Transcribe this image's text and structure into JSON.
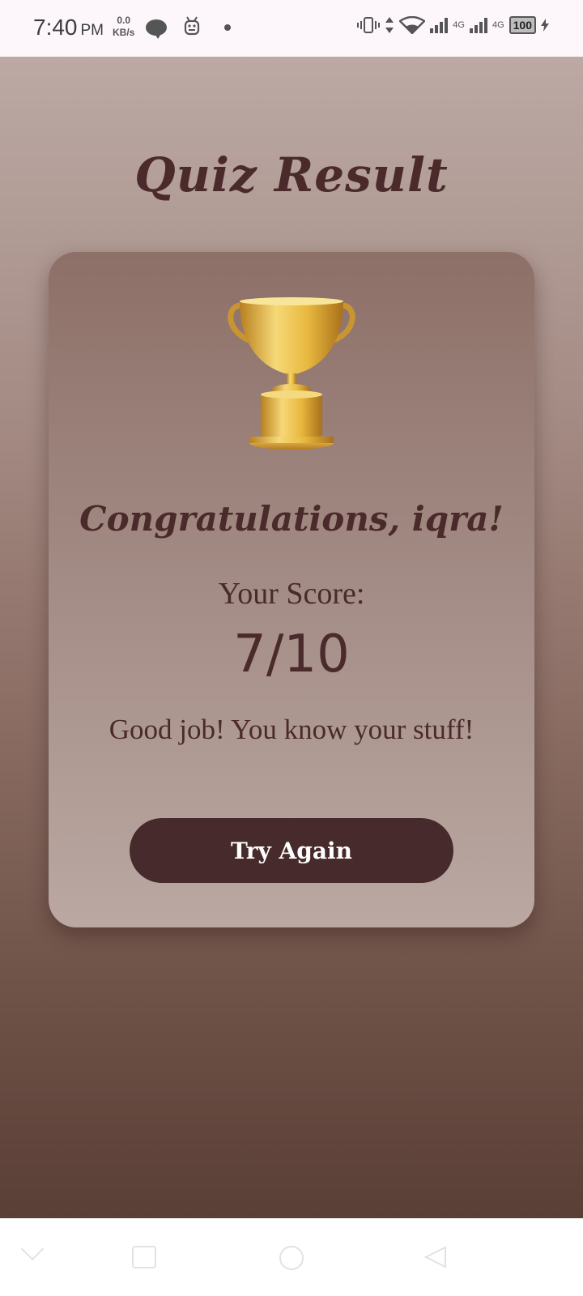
{
  "status_bar": {
    "time": "7:40",
    "ampm": "PM",
    "speed_value": "0.0",
    "speed_unit": "KB/s",
    "network_1": "4G",
    "network_2": "4G",
    "battery": "100",
    "icons": [
      "chat-bubble-icon",
      "android-icon",
      "dot-icon",
      "vibrate-icon",
      "data-arrows-icon",
      "wifi-icon",
      "signal-icon",
      "battery-icon",
      "charging-icon"
    ]
  },
  "quiz": {
    "title": "Quiz Result",
    "congrats": "Congratulations, iqra!",
    "score_label": "Your Score:",
    "score_value": "7/10",
    "message": "Good job! You know your stuff!",
    "try_again_label": "Try Again",
    "trophy_icon": "trophy-icon"
  },
  "colors": {
    "text": "#4a2a2a",
    "button_bg": "#472a2b",
    "button_text": "#ffffff"
  },
  "navbar": {
    "icons": [
      "nav-down-icon",
      "recents-square-icon",
      "home-circle-icon",
      "back-triangle-icon"
    ]
  }
}
